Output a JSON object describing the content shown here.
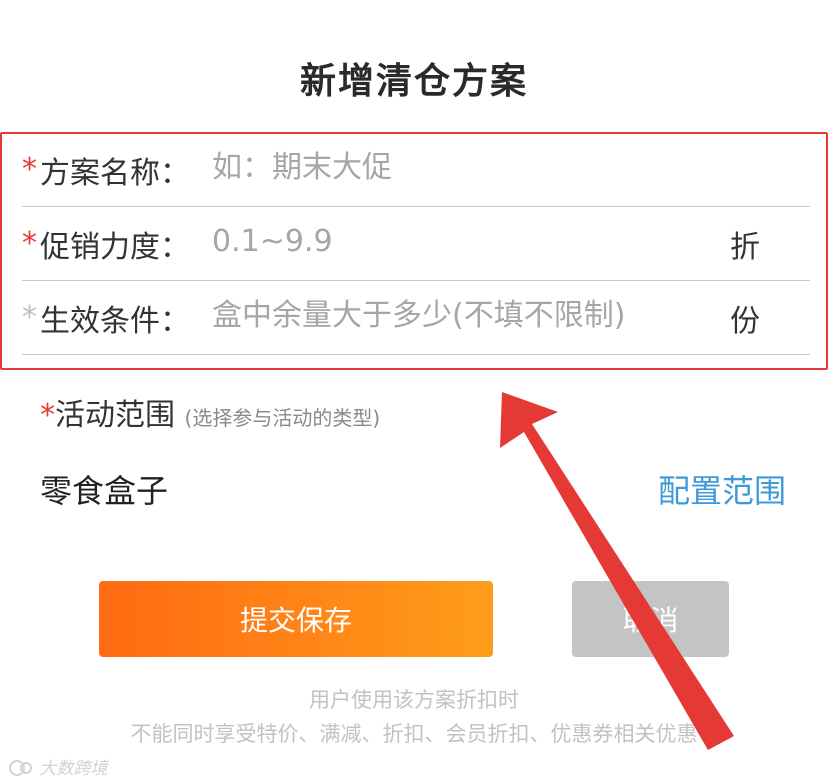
{
  "dialog": {
    "title": "新增清仓方案"
  },
  "form": {
    "rows": [
      {
        "required_mark": "*",
        "label": "方案名称：",
        "placeholder": "如：期末大促",
        "value": "",
        "unit": ""
      },
      {
        "required_mark": "*",
        "label": "促销力度：",
        "placeholder": "0.1~9.9",
        "value": "",
        "unit": "折"
      },
      {
        "required_mark": "*",
        "label": "生效条件：",
        "placeholder": "盒中余量大于多少(不填不限制)",
        "value": "",
        "unit": "份"
      }
    ]
  },
  "scope": {
    "required_mark": "*",
    "label": "活动范围",
    "hint": "(选择参与活动的类型)",
    "item": "零食盒子",
    "configure_link": "配置范围"
  },
  "actions": {
    "submit_label": "提交保存",
    "cancel_label": "取消"
  },
  "notice": {
    "line1": "用户使用该方案折扣时",
    "line2": "不能同时享受特价、满减、折扣、会员折扣、优惠券相关优惠"
  },
  "watermark": "大数跨境",
  "colors": {
    "required": "#e53935",
    "highlight_box": "#e53935",
    "arrow": "#e53935",
    "link": "#3d9ad9",
    "submit_gradient_start": "#ff6a12",
    "submit_gradient_end": "#ff9d1a",
    "cancel_bg": "#c4c4c4"
  },
  "icons": {
    "arrow": "red-pointer-arrow",
    "watermark_logo": "brand-logo"
  }
}
